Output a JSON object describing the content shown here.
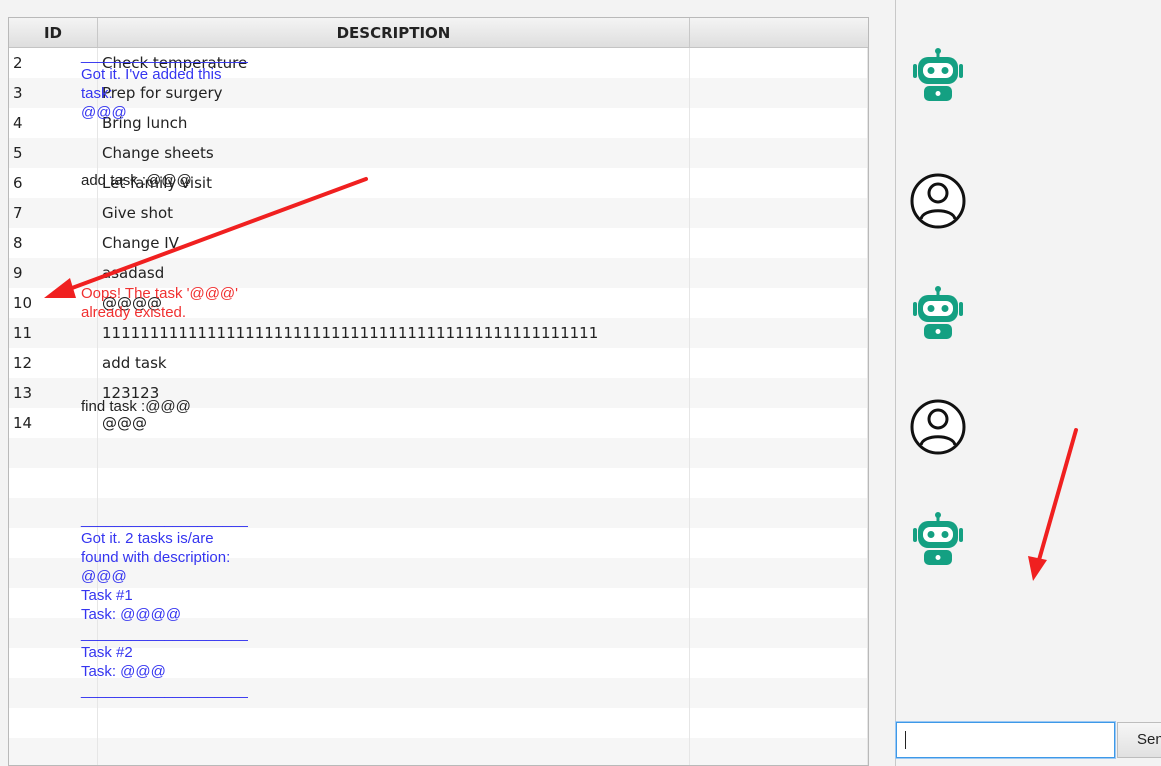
{
  "table": {
    "headers": [
      "ID",
      "DESCRIPTION",
      ""
    ],
    "rows": [
      {
        "id": "2",
        "description": "Check temperature"
      },
      {
        "id": "3",
        "description": "Prep for surgery"
      },
      {
        "id": "4",
        "description": "Bring lunch"
      },
      {
        "id": "5",
        "description": "Change sheets"
      },
      {
        "id": "6",
        "description": "Let family visit"
      },
      {
        "id": "7",
        "description": "Give shot"
      },
      {
        "id": "8",
        "description": "Change IV"
      },
      {
        "id": "9",
        "description": "asadasd"
      },
      {
        "id": "10",
        "description": "@@@@"
      },
      {
        "id": "11",
        "description": "1111111111111111111111111111111111111111111111111111"
      },
      {
        "id": "12",
        "description": "add task"
      },
      {
        "id": "13",
        "description": "123123"
      },
      {
        "id": "14",
        "description": "@@@"
      },
      {
        "id": "",
        "description": ""
      },
      {
        "id": "",
        "description": ""
      },
      {
        "id": "",
        "description": ""
      },
      {
        "id": "",
        "description": ""
      },
      {
        "id": "",
        "description": ""
      },
      {
        "id": "",
        "description": ""
      },
      {
        "id": "",
        "description": ""
      },
      {
        "id": "",
        "description": ""
      },
      {
        "id": "",
        "description": ""
      },
      {
        "id": "",
        "description": ""
      },
      {
        "id": "",
        "description": ""
      },
      {
        "id": "",
        "description": ""
      }
    ]
  },
  "chat": {
    "messages": [
      {
        "sender": "bot",
        "text": "____________________\nGot it. I've added this\ntask:\n@@@"
      },
      {
        "sender": "user",
        "text": "add task :@@@"
      },
      {
        "sender": "bot-error",
        "text": "Oops! The task '@@@'\nalready existed."
      },
      {
        "sender": "user",
        "text": "find task :@@@"
      },
      {
        "sender": "bot",
        "text": "____________________\nGot it. 2 tasks is/are\nfound with description:\n@@@\nTask #1\nTask: @@@@\n____________________\nTask #2\nTask: @@@\n____________________"
      }
    ],
    "input_value": "",
    "send_label": "Send",
    "colors": {
      "bot": "#3535f0",
      "error": "#f03030",
      "robot": "#14a082"
    },
    "icons": {
      "bot": "robot-icon",
      "user": "user-avatar-icon"
    }
  },
  "annotations": {
    "color": "#f02020"
  }
}
